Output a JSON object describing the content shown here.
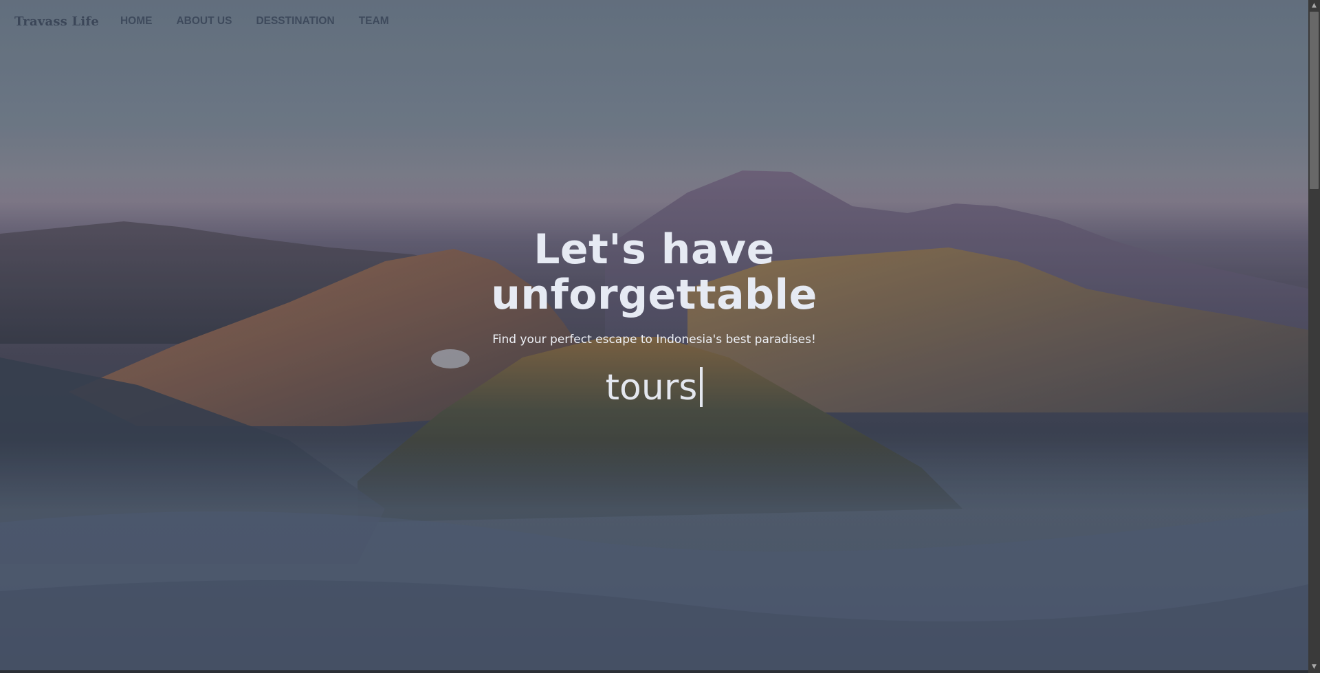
{
  "nav": {
    "brand": "Travass Life",
    "links": [
      {
        "label": "HOME"
      },
      {
        "label": "ABOUT US"
      },
      {
        "label": "DESSTINATION"
      },
      {
        "label": "TEAM"
      }
    ]
  },
  "hero": {
    "headline_line1": "Let's have",
    "headline_line2": "unforgettable",
    "subtitle": "Find your perfect escape to Indonesia's best paradises!",
    "typed_word": "tours"
  },
  "colors": {
    "nav_text": "#3e4a5c",
    "hero_text": "#e6eaf3"
  },
  "icons": {
    "scroll_up": "chevron-up-icon",
    "scroll_down": "chevron-down-icon"
  }
}
